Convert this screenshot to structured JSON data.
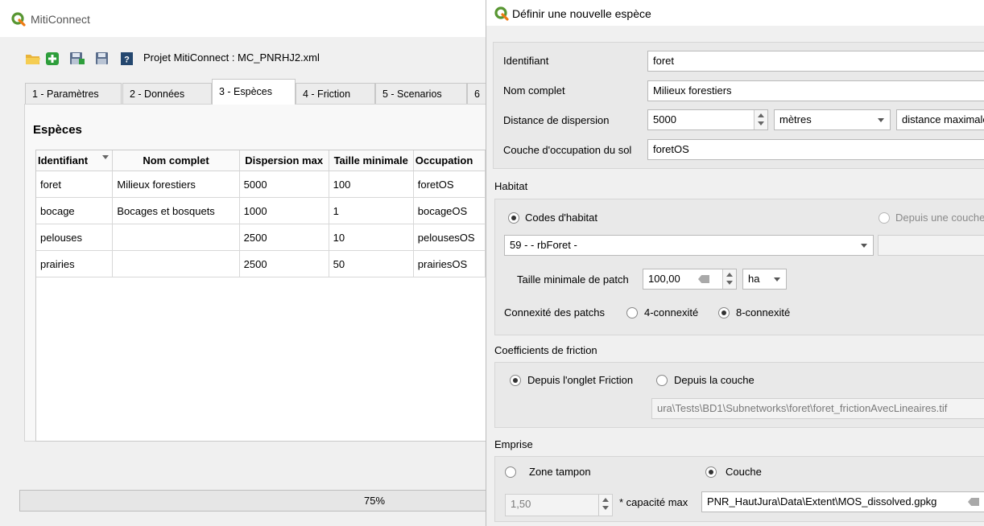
{
  "main_window": {
    "title": "MitiConnect",
    "project_label": "Projet MitiConnect : MC_PNRHJ2.xml",
    "toolbar_icons": [
      "open-folder-icon",
      "add-icon",
      "save-as-icon",
      "save-icon",
      "help-icon"
    ],
    "tabs": [
      {
        "label": "1 - Paramètres",
        "active": false
      },
      {
        "label": "2 - Données",
        "active": false
      },
      {
        "label": "3 - Espèces",
        "active": true
      },
      {
        "label": "4 - Friction",
        "active": false
      },
      {
        "label": "5 - Scenarios",
        "active": false
      },
      {
        "label": "6",
        "active": false
      }
    ],
    "section_title": "Espèces",
    "table": {
      "headers": [
        "Identifiant",
        "Nom complet",
        "Dispersion max",
        "Taille minimale",
        "Occupation"
      ],
      "rows": [
        [
          "foret",
          "Milieux forestiers",
          "5000",
          "100",
          "foretOS"
        ],
        [
          "bocage",
          "Bocages et bosquets",
          "1000",
          "1",
          "bocageOS"
        ],
        [
          "pelouses",
          "",
          "2500",
          "10",
          "pelousesOS"
        ],
        [
          "prairies",
          "",
          "2500",
          "50",
          "prairiesOS"
        ]
      ]
    },
    "progress": {
      "value": 0.75,
      "label": "75%"
    }
  },
  "dialog": {
    "title": "Définir une nouvelle espèce",
    "identifiant_label": "Identifiant",
    "identifiant_value": "foret",
    "nom_label": "Nom complet",
    "nom_value": "Milieux forestiers",
    "distance_label": "Distance de dispersion",
    "distance_value": "5000",
    "distance_unit": "mètres",
    "distance_mode": "distance maximale",
    "couche_label": "Couche d'occupation du sol",
    "couche_value": "foretOS",
    "habitat": {
      "title": "Habitat",
      "codes_label": "Codes d'habitat",
      "depuis_couche_label": "Depuis une couche",
      "codes_value": "59 -  - rbForet -",
      "taille_label": "Taille minimale de patch",
      "taille_value": "100,00",
      "taille_unit": "ha",
      "connex_label": "Connexité des patchs",
      "connex4": "4-connexité",
      "connex8": "8-connexité"
    },
    "friction": {
      "title": "Coefficients de friction",
      "onglet_label": "Depuis l'onglet Friction",
      "couche_label": "Depuis la couche",
      "path": "ura\\Tests\\BD1\\Subnetworks\\foret\\foret_frictionAvecLineaires.tif"
    },
    "emprise": {
      "title": "Emprise",
      "zone_label": "Zone tampon",
      "couche_label": "Couche",
      "buffer_value": "1,50",
      "capacite_label": "* capacité max",
      "path": "PNR_HautJura\\Data\\Extent\\MOS_dissolved.gpkg"
    }
  },
  "colors": {
    "qgis_green": "#589632",
    "window_bg": "#f0f0f0"
  }
}
